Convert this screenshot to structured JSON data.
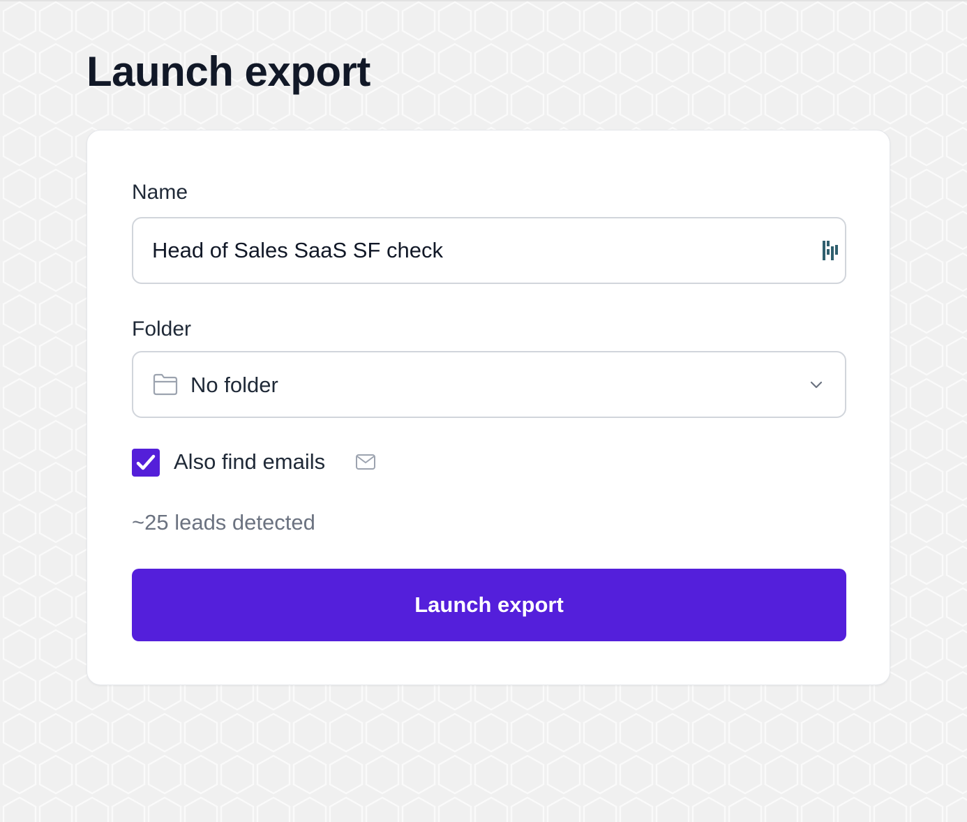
{
  "page": {
    "title": "Launch export"
  },
  "form": {
    "name_label": "Name",
    "name_value": "Head of Sales SaaS SF check",
    "folder_label": "Folder",
    "folder_value": "No folder",
    "find_emails_label": "Also find emails",
    "find_emails_checked": true,
    "leads_detected": "~25 leads detected",
    "submit_label": "Launch export"
  },
  "icons": {
    "input_extension": "password-manager-icon",
    "folder": "folder-icon",
    "dropdown": "chevron-down-icon",
    "checkbox": "checkmark-icon",
    "email": "mail-icon"
  },
  "colors": {
    "accent": "#541fdb",
    "page_background": "#f0f0f0",
    "card_background": "#ffffff",
    "title_text": "#111827",
    "muted_text": "#6b7280",
    "input_border": "#d1d5db",
    "extension_icon": "#2f5f6e"
  }
}
